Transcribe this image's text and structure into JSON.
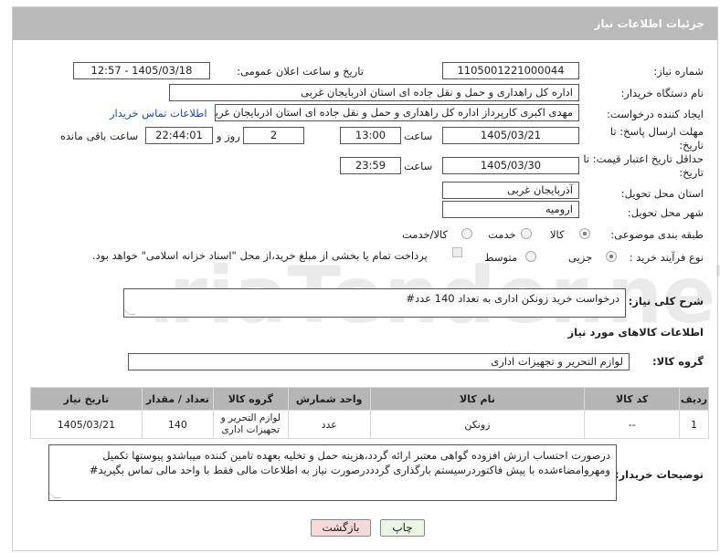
{
  "header": {
    "title": "جزئیات اطلاعات نیاز"
  },
  "form": {
    "need_number_label": "شماره نیاز:",
    "need_number": "1105001221000044",
    "announce_label": "تاریخ و ساعت اعلان عمومی:",
    "announce_value": "1405/03/18 - 12:57",
    "buyer_org_label": "نام دستگاه خریدار:",
    "buyer_org": "اداره کل راهداری و حمل و نقل جاده ای استان اذربایجان غربی",
    "requester_label": "ایجاد کننده درخواست:",
    "requester": "مهدی اکبری کارپرداز اداره کل راهداری و حمل و نقل جاده ای استان اذربایجان غربی",
    "contact_link": "اطلاعات تماس خریدار",
    "reply_deadline_label": "مهلت ارسال پاسخ: تا تاریخ:",
    "reply_date": "1405/03/21",
    "time_label": "ساعت",
    "reply_time": "13:00",
    "days_value": "2",
    "days_label": "روز و",
    "remaining_time": "22:44:01",
    "remaining_label": "ساعت باقی مانده",
    "price_validity_label": "حداقل تاریخ اعتبار قیمت: تا تاریخ:",
    "price_date": "1405/03/30",
    "price_time": "23:59",
    "province_label": "استان محل تحویل:",
    "province": "آذربایجان غربی",
    "city_label": "شهر محل تحویل:",
    "city": "ارومیه",
    "category_label": "طبقه بندی موضوعی:",
    "category_options": [
      "کالا",
      "خدمت",
      "کالا/خدمت"
    ],
    "process_label": "نوع فرآیند خرید :",
    "process_options": [
      "جزیی",
      "متوسط"
    ],
    "payment_note": "پرداخت تمام یا بخشی از مبلغ خرید،از محل \"اسناد خزانه اسلامی\" خواهد بود."
  },
  "description": {
    "label": "شرح کلی نیاز:",
    "text": "درخواست خرید زونکن اداری به تعداد 140 عدد#"
  },
  "goods_info": {
    "section_title": "اطلاعات کالاهای مورد نیاز",
    "group_label": "گروه کالا:",
    "group_value": "لوازم التحریر و تجهیزات اداری"
  },
  "table": {
    "headers": [
      "ردیف",
      "کد کالا",
      "نام کالا",
      "واحد شمارش",
      "گروه کالا",
      "تعداد / مقدار",
      "تاریخ نیاز"
    ],
    "rows": [
      [
        "1",
        "--",
        "زونکن",
        "عدد",
        "لوازم التحریر و تجهیزات اداری",
        "140",
        "1405/03/21"
      ]
    ]
  },
  "buyer_notes": {
    "label": "توضیحات خریدار:",
    "line1": "درصورت احتساب ارزش افزوده گواهی معتبر ارائه گردد،هزینه حمل و تخلیه بعهده تامین کننده میباشدو پیوستها تکمیل",
    "line2": "ومهروامضاءشده با پیش فاکتوردرسیستم بارگذاری گردددرصورت نیاز به اطلاعات مالی فقط با واحد مالی تماس بگیرید#"
  },
  "buttons": {
    "print": "چاپ",
    "back": "بازگشت"
  },
  "watermark": {
    "text": "AriaTender.neT"
  },
  "colors": {
    "header_bg": "#b9b9b9",
    "table_header_bg": "#b5b5b5",
    "back_button_bg": "#f7d9d9",
    "print_button_bg": "#eaf5e4",
    "link": "#1a4fa3"
  }
}
